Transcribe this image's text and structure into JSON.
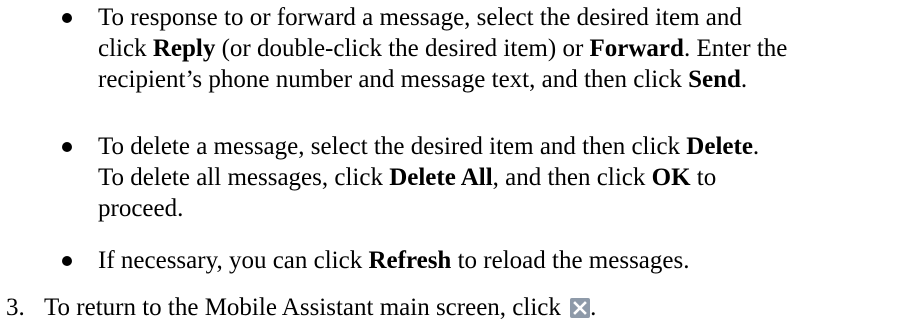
{
  "bullets": [
    {
      "lines": [
        [
          "To response to or forward a message, select the desired item and"
        ],
        [
          "click ",
          {
            "b": "Reply"
          },
          " (or double-click the desired item) or ",
          {
            "b": "Forward"
          },
          ". Enter the"
        ],
        [
          "recipient’s phone number and message text, and then click ",
          {
            "b": "Send"
          },
          "."
        ]
      ]
    },
    {
      "lines": [
        [
          "To delete a message, select the desired item and then click ",
          {
            "b": "Delete"
          },
          "."
        ],
        [
          "To delete all messages, click ",
          {
            "b": "Delete All"
          },
          ", and then click ",
          {
            "b": "OK"
          },
          " to"
        ],
        [
          "proceed."
        ]
      ]
    },
    {
      "lines": [
        [
          "If necessary, you can click ",
          {
            "b": "Refresh"
          },
          " to reload the messages."
        ]
      ]
    }
  ],
  "step": {
    "number": "3.",
    "text": "To return to the Mobile Assistant main screen, click",
    "icon": "close-icon",
    "suffix": "."
  },
  "colors": {
    "text": "#000000",
    "close_icon_bg": "#8e9aa9",
    "close_icon_fg": "#ffffff"
  }
}
